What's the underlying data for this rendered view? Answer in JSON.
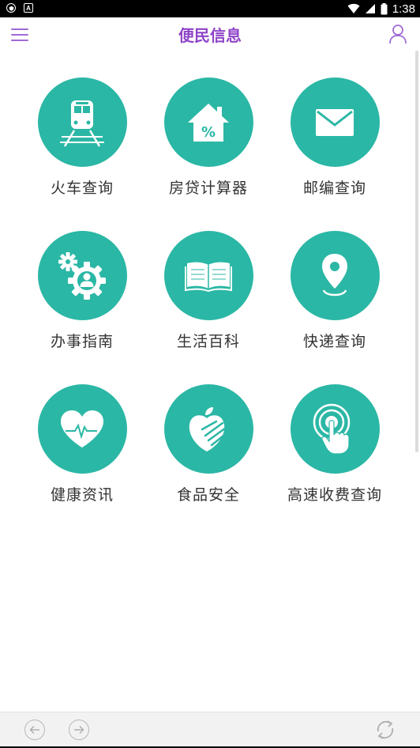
{
  "status_bar": {
    "time": "1:38",
    "notif_icons": [
      "shield-icon",
      "a-icon"
    ],
    "sys_icons": [
      "wifi-icon",
      "signal-icon",
      "battery-icon"
    ]
  },
  "app_bar": {
    "title": "便民信息",
    "accent_color": "#8e44c8"
  },
  "tile_color": "#2bb7a5",
  "tiles": [
    {
      "label": "火车查询",
      "icon": "train-icon"
    },
    {
      "label": "房贷计算器",
      "icon": "house-percent-icon"
    },
    {
      "label": "邮编查询",
      "icon": "envelope-icon"
    },
    {
      "label": "办事指南",
      "icon": "gears-person-icon"
    },
    {
      "label": "生活百科",
      "icon": "open-book-icon"
    },
    {
      "label": "快递查询",
      "icon": "location-pin-icon"
    },
    {
      "label": "健康资讯",
      "icon": "heart-pulse-icon"
    },
    {
      "label": "食品安全",
      "icon": "apple-hand-icon"
    },
    {
      "label": "高速收费查询",
      "icon": "touch-target-icon"
    }
  ],
  "bottom_bar": {
    "icons": [
      "back-arrow-icon",
      "forward-arrow-icon",
      "refresh-icon"
    ]
  }
}
